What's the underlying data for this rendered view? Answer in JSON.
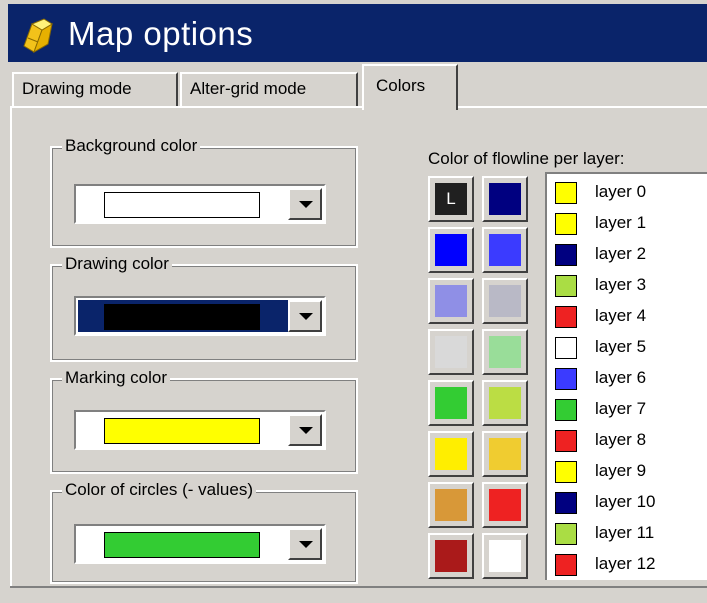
{
  "window": {
    "title": "Map options",
    "icon": "map-pencil-icon"
  },
  "tabs": [
    {
      "label": "Drawing mode",
      "active": false
    },
    {
      "label": "Alter-grid mode",
      "active": false
    },
    {
      "label": "Colors",
      "active": true
    }
  ],
  "groups": {
    "background": {
      "label": "Background color",
      "value_color": "#ffffff"
    },
    "drawing": {
      "label": "Drawing color",
      "value_color": "#000000",
      "highlight_color": "#0a246a"
    },
    "marking": {
      "label": "Marking color",
      "value_color": "#ffff00"
    },
    "circles": {
      "label": "Color of circles (- values)",
      "value_color": "#33cc33"
    }
  },
  "flowline": {
    "label": "Color of flowline per layer:",
    "palette": [
      {
        "name": "L",
        "color": "#202020",
        "label": "L"
      },
      {
        "name": "navy",
        "color": "#000080"
      },
      {
        "name": "blue",
        "color": "#0000ff"
      },
      {
        "name": "blue-dotted",
        "color": "#3b3bff"
      },
      {
        "name": "light-blue-dotted",
        "color": "#8f8fe6"
      },
      {
        "name": "grey-dotted",
        "color": "#b9b9c6"
      },
      {
        "name": "light-grey-dotted",
        "color": "#d9d9d9"
      },
      {
        "name": "light-green-dotted",
        "color": "#99dd99"
      },
      {
        "name": "green",
        "color": "#33cc33"
      },
      {
        "name": "yellow-green-dotted",
        "color": "#bbdd44"
      },
      {
        "name": "yellow",
        "color": "#ffee00"
      },
      {
        "name": "yellow-orange-dotted",
        "color": "#f0cc30"
      },
      {
        "name": "orange-dotted",
        "color": "#d89838"
      },
      {
        "name": "red-dotted",
        "color": "#ee2222"
      },
      {
        "name": "dark-red",
        "color": "#aa1a1a"
      },
      {
        "name": "white",
        "color": "#ffffff"
      }
    ],
    "layers": [
      {
        "label": "layer 0",
        "color": "#ffff00"
      },
      {
        "label": "layer 1",
        "color": "#ffff00"
      },
      {
        "label": "layer 2",
        "color": "#000080"
      },
      {
        "label": "layer 3",
        "color": "#aadd44"
      },
      {
        "label": "layer 4",
        "color": "#ee2222"
      },
      {
        "label": "layer 5",
        "color": "#ffffff"
      },
      {
        "label": "layer 6",
        "color": "#3b3bff"
      },
      {
        "label": "layer 7",
        "color": "#33cc33"
      },
      {
        "label": "layer 8",
        "color": "#ee2222"
      },
      {
        "label": "layer 9",
        "color": "#ffff00"
      },
      {
        "label": "layer 10",
        "color": "#000080"
      },
      {
        "label": "layer 11",
        "color": "#aadd44"
      },
      {
        "label": "layer 12",
        "color": "#ee2222"
      }
    ]
  }
}
